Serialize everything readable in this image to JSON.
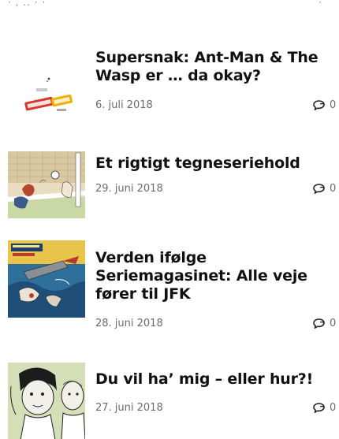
{
  "top_fragment": {
    "left": "· , .. · ·",
    "right": "·"
  },
  "posts": [
    {
      "title": "Supersnak: Ant-Man & The Wasp er … da okay?",
      "date": "6. juli 2018",
      "comments": "0",
      "thumb_icon": "ant-man-wasp-poster-thumbnail"
    },
    {
      "title": "Et rigtigt tegneseriehold",
      "date": "29. juni 2018",
      "comments": "0",
      "thumb_icon": "football-goal-comic-thumbnail"
    },
    {
      "title": "Verden ifølge Seriemagasinet: Alle veje fører til JFK",
      "date": "28. juni 2018",
      "comments": "0",
      "thumb_icon": "comic-cover-thumbnail"
    },
    {
      "title": "Du vil ha’ mig – eller hur?!",
      "date": "27. juni 2018",
      "comments": "0",
      "thumb_icon": "cartoon-faces-thumbnail"
    }
  ],
  "colors": {
    "title": "#111111",
    "meta": "#6b6b6b"
  }
}
